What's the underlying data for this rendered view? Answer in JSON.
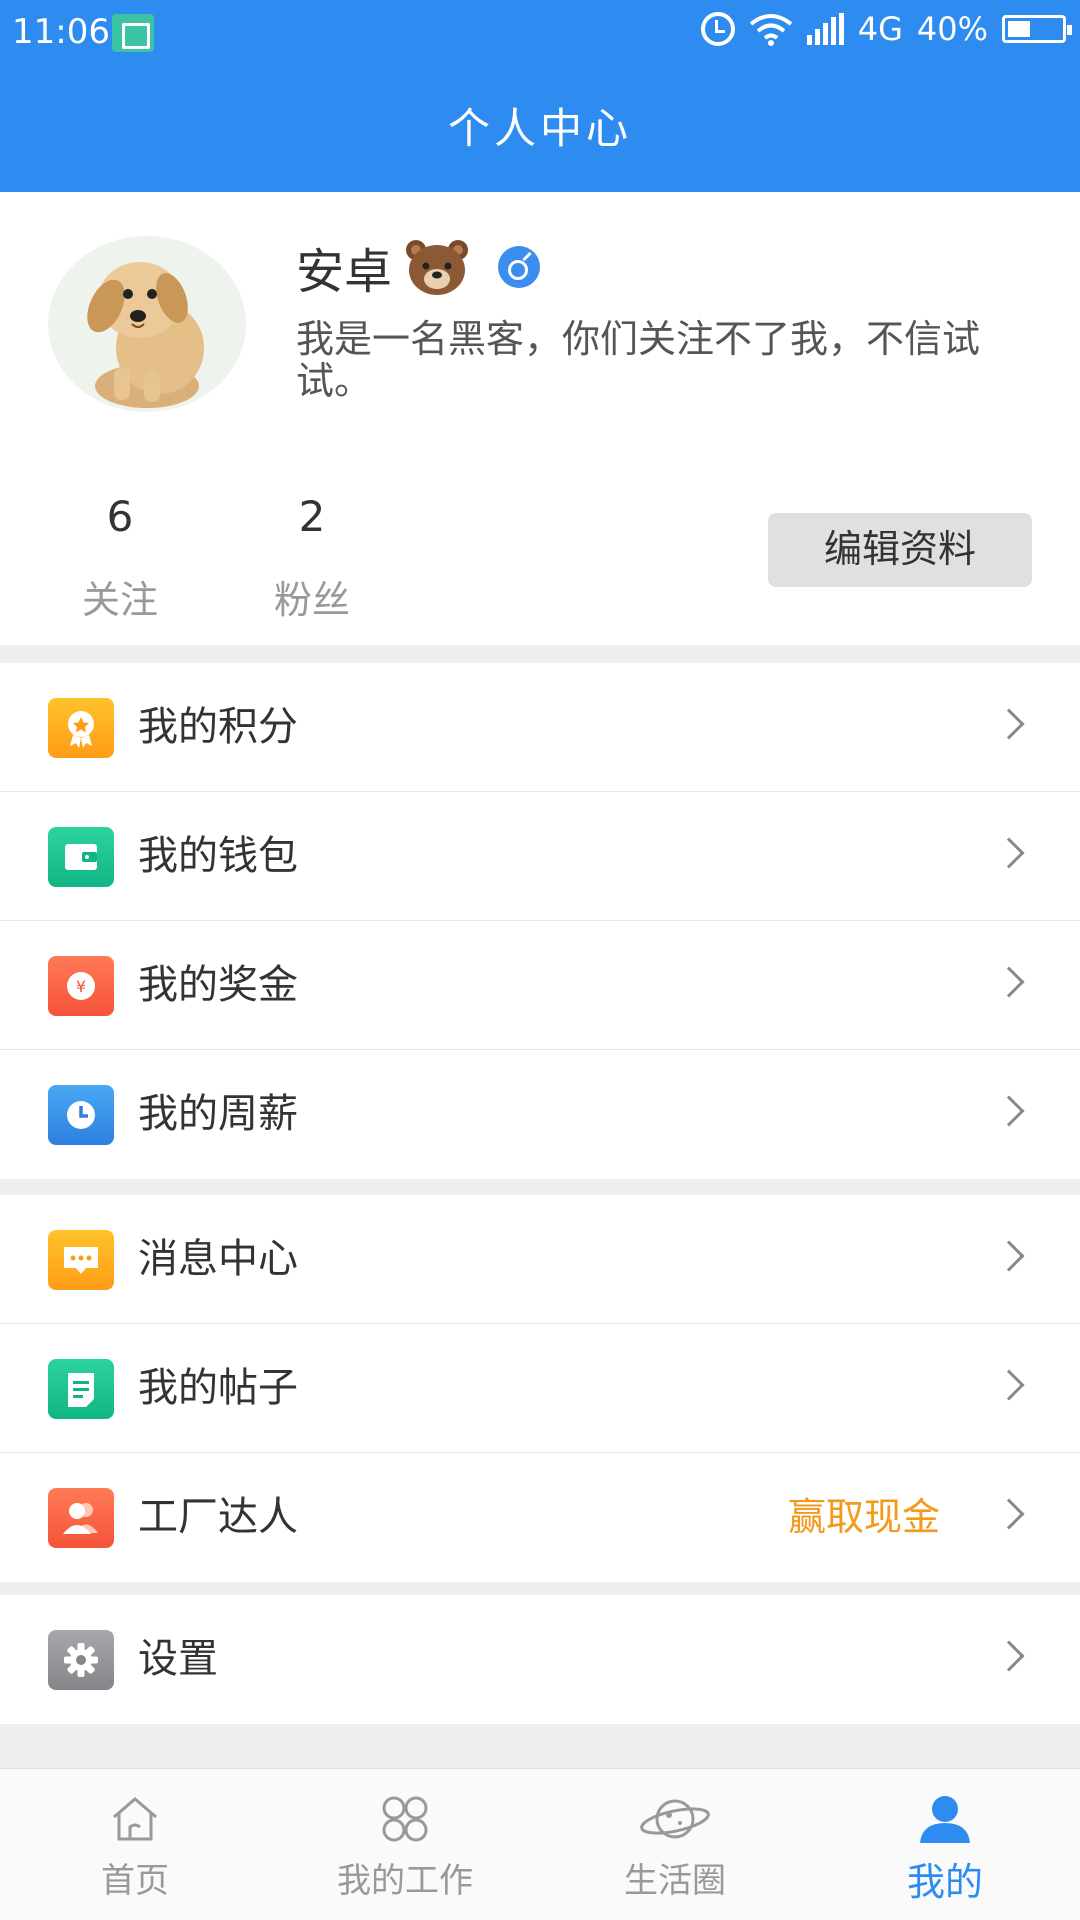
{
  "status_bar": {
    "time": "11:06",
    "network": "4G",
    "battery": "40%"
  },
  "header": {
    "title": "个人中心"
  },
  "profile": {
    "name": "安卓",
    "bio": "我是一名黑客，你们关注不了我，不信试试。",
    "following_count": "6",
    "following_label": "关注",
    "fans_count": "2",
    "fans_label": "粉丝",
    "edit_label": "编辑资料"
  },
  "menu_group1": [
    {
      "label": "我的积分",
      "icon": "medal-icon"
    },
    {
      "label": "我的钱包",
      "icon": "wallet-icon"
    },
    {
      "label": "我的奖金",
      "icon": "coin-icon"
    },
    {
      "label": "我的周薪",
      "icon": "clock-icon"
    }
  ],
  "menu_group2": [
    {
      "label": "消息中心",
      "icon": "chat-icon"
    },
    {
      "label": "我的帖子",
      "icon": "note-icon"
    },
    {
      "label": "工厂达人",
      "icon": "people-icon",
      "extra": "赢取现金"
    }
  ],
  "menu_group3": [
    {
      "label": "设置",
      "icon": "gear-icon"
    }
  ],
  "tabbar": [
    {
      "label": "首页",
      "icon": "home-icon"
    },
    {
      "label": "我的工作",
      "icon": "grid-icon"
    },
    {
      "label": "生活圈",
      "icon": "planet-icon"
    },
    {
      "label": "我的",
      "icon": "user-icon",
      "active": true
    }
  ],
  "colors": {
    "primary": "#2e8cf0",
    "accent_orange": "#f39a1d"
  }
}
